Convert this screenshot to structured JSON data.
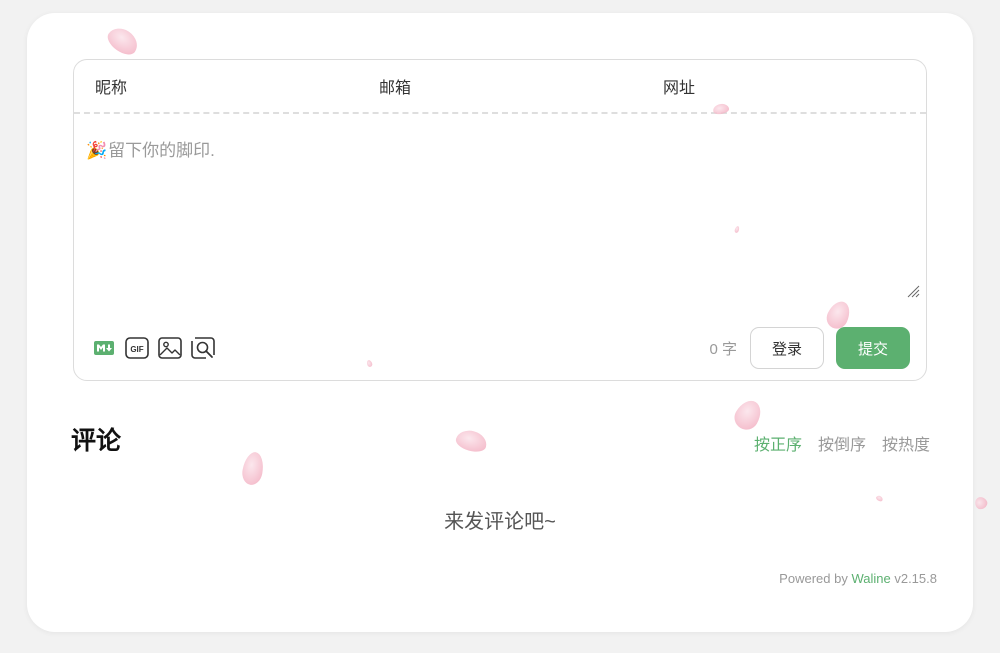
{
  "header": {
    "nickname_label": "昵称",
    "email_label": "邮箱",
    "url_label": "网址"
  },
  "editor": {
    "emoji": "🎉",
    "placeholder": "留下你的脚印."
  },
  "toolbar": {
    "markdown_icon": "markdown-icon",
    "gif_icon": "gif-icon",
    "image_icon": "image-icon",
    "preview_icon": "preview-icon"
  },
  "actions": {
    "word_count": "0 字",
    "login_label": "登录",
    "submit_label": "提交"
  },
  "comments": {
    "title": "评论",
    "sort_tabs": [
      "按正序",
      "按倒序",
      "按热度"
    ],
    "empty_text": "来发评论吧~"
  },
  "footer": {
    "powered_by": "Powered by",
    "brand": "Waline",
    "version": "v2.15.8"
  },
  "colors": {
    "accent": "#5cb070",
    "background": "#f2f2f2",
    "card": "#ffffff",
    "petal": "#f4b8c8"
  }
}
